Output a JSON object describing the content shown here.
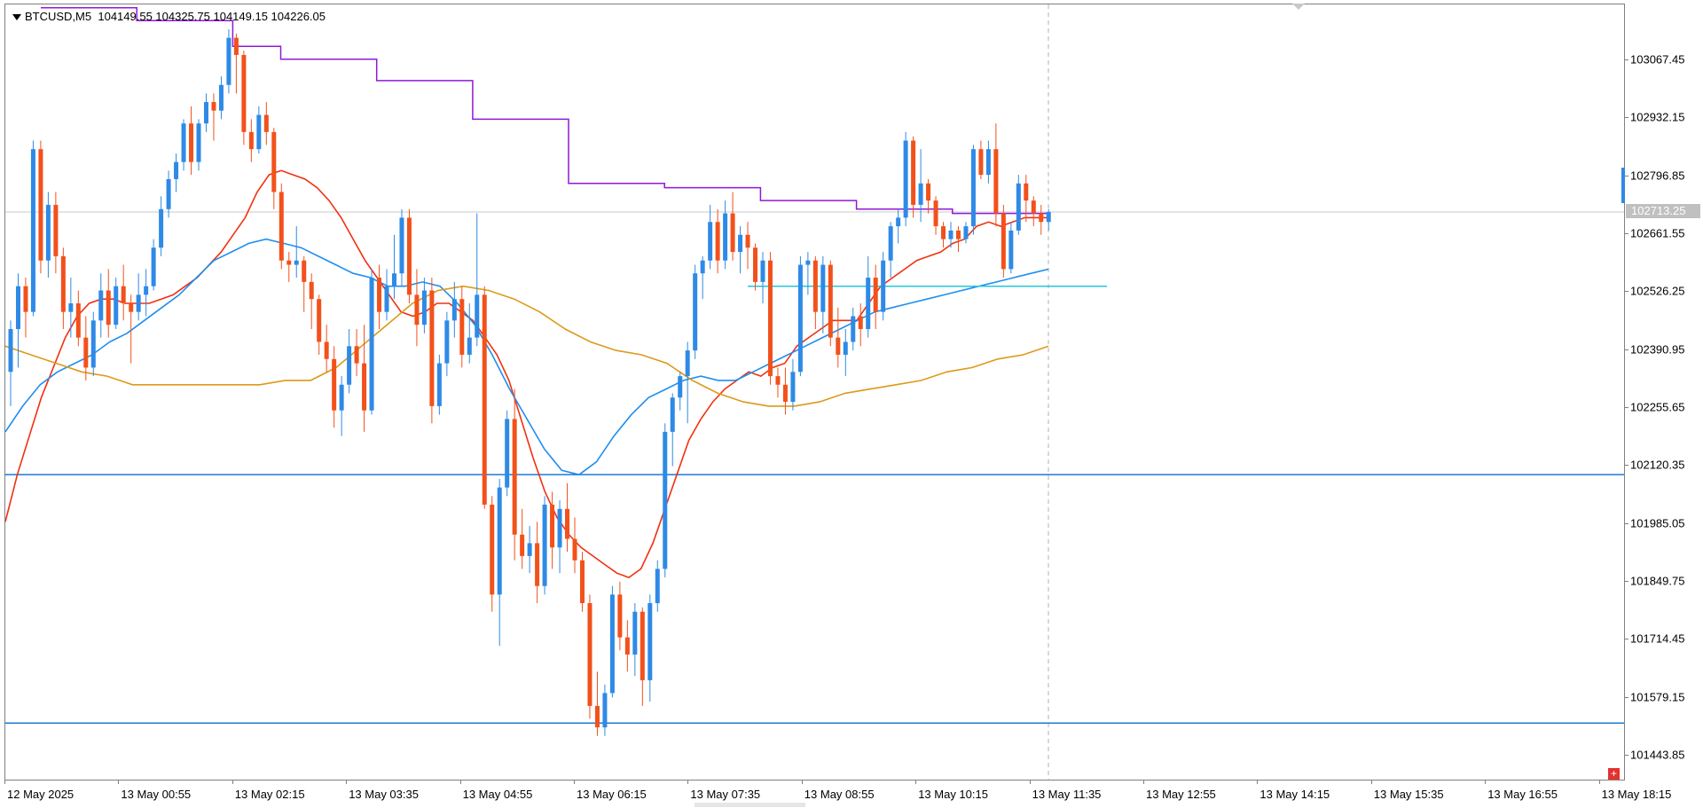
{
  "symbol": {
    "name": "BTCUSD,M5",
    "ohlc": "104149.55 104325.75 104149.15 104226.05"
  },
  "price_axis": {
    "labels": [
      "103067.45",
      "102932.15",
      "102796.85",
      "102661.55",
      "102526.25",
      "102390.95",
      "102255.65",
      "102120.35",
      "101985.05",
      "101849.75",
      "101714.45",
      "101579.15",
      "101443.85"
    ]
  },
  "current_price": {
    "label": "102713.25",
    "value": 102713.25
  },
  "time_axis": {
    "labels": [
      "12 May 2025",
      "13 May 00:55",
      "13 May 02:15",
      "13 May 03:35",
      "13 May 04:55",
      "13 May 06:15",
      "13 May 07:35",
      "13 May 08:55",
      "13 May 10:15",
      "13 May 11:35",
      "13 May 12:55",
      "13 May 14:15",
      "13 May 15:35",
      "13 May 16:55",
      "13 May 18:15"
    ]
  },
  "scroll_marker": {
    "label": "+"
  },
  "colors": {
    "bull": "#2e8ae6",
    "bear": "#f2511b",
    "ma_fast": "#f2300f",
    "ma_mid": "#1e8ef0",
    "ma_slow": "#dc9a19",
    "step_line": "#9019d6",
    "hline": "#1b78d8",
    "cyan_line": "#26c6da",
    "grid_price": "#c8c8c8",
    "vline": "#b0b0b0"
  },
  "chart_data": {
    "type": "candlestick",
    "timeframe": "M5",
    "ylim": [
      101400,
      103160
    ],
    "candles": [
      [
        102340,
        102460,
        102260,
        102440
      ],
      [
        102440,
        102570,
        102350,
        102540
      ],
      [
        102540,
        102560,
        102420,
        102480
      ],
      [
        102480,
        102880,
        102470,
        102860
      ],
      [
        102860,
        102880,
        102570,
        102600
      ],
      [
        102600,
        102760,
        102560,
        102730
      ],
      [
        102730,
        102760,
        102570,
        102610
      ],
      [
        102610,
        102630,
        102440,
        102480
      ],
      [
        102480,
        102560,
        102420,
        102500
      ],
      [
        102500,
        102530,
        102400,
        102420
      ],
      [
        102420,
        102470,
        102320,
        102350
      ],
      [
        102350,
        102480,
        102330,
        102460
      ],
      [
        102460,
        102570,
        102420,
        102530
      ],
      [
        102530,
        102580,
        102420,
        102450
      ],
      [
        102450,
        102560,
        102440,
        102540
      ],
      [
        102540,
        102590,
        102460,
        102500
      ],
      [
        102500,
        102520,
        102360,
        102480
      ],
      [
        102480,
        102570,
        102460,
        102520
      ],
      [
        102520,
        102580,
        102470,
        102540
      ],
      [
        102540,
        102650,
        102530,
        102630
      ],
      [
        102630,
        102750,
        102610,
        102720
      ],
      [
        102720,
        102810,
        102700,
        102790
      ],
      [
        102790,
        102850,
        102760,
        102830
      ],
      [
        102830,
        102930,
        102810,
        102920
      ],
      [
        102920,
        102960,
        102800,
        102830
      ],
      [
        102830,
        102930,
        102810,
        102920
      ],
      [
        102920,
        102990,
        102900,
        102970
      ],
      [
        102970,
        102990,
        102880,
        102950
      ],
      [
        102950,
        103030,
        102930,
        103010
      ],
      [
        103010,
        103140,
        102990,
        103120
      ],
      [
        103120,
        103130,
        102990,
        103080
      ],
      [
        103080,
        103090,
        102870,
        102900
      ],
      [
        102900,
        102930,
        102830,
        102860
      ],
      [
        102860,
        102960,
        102850,
        102940
      ],
      [
        102940,
        102970,
        102870,
        102900
      ],
      [
        102900,
        102910,
        102720,
        102760
      ],
      [
        102760,
        102780,
        102580,
        102600
      ],
      [
        102600,
        102620,
        102550,
        102590
      ],
      [
        102590,
        102680,
        102560,
        102600
      ],
      [
        102600,
        102610,
        102480,
        102550
      ],
      [
        102550,
        102570,
        102440,
        102510
      ],
      [
        102510,
        102520,
        102380,
        102410
      ],
      [
        102410,
        102450,
        102340,
        102370
      ],
      [
        102370,
        102400,
        102210,
        102250
      ],
      [
        102250,
        102330,
        102190,
        102310
      ],
      [
        102310,
        102440,
        102290,
        102400
      ],
      [
        102400,
        102440,
        102330,
        102360
      ],
      [
        102360,
        102450,
        102200,
        102250
      ],
      [
        102250,
        102580,
        102240,
        102560
      ],
      [
        102560,
        102590,
        102440,
        102480
      ],
      [
        102480,
        102580,
        102460,
        102540
      ],
      [
        102540,
        102660,
        102510,
        102570
      ],
      [
        102570,
        102720,
        102540,
        102700
      ],
      [
        102700,
        102720,
        102500,
        102520
      ],
      [
        102520,
        102580,
        102400,
        102450
      ],
      [
        102450,
        102560,
        102430,
        102530
      ],
      [
        102530,
        102560,
        102220,
        102260
      ],
      [
        102260,
        102380,
        102240,
        102360
      ],
      [
        102360,
        102480,
        102330,
        102460
      ],
      [
        102460,
        102550,
        102420,
        102510
      ],
      [
        102510,
        102540,
        102350,
        102380
      ],
      [
        102380,
        102500,
        102360,
        102420
      ],
      [
        102420,
        102710,
        102400,
        102520
      ],
      [
        102520,
        102540,
        102020,
        102030
      ],
      [
        102030,
        102050,
        101780,
        101820
      ],
      [
        101820,
        102090,
        101700,
        102070
      ],
      [
        102070,
        102250,
        102050,
        102230
      ],
      [
        102230,
        102300,
        101900,
        101960
      ],
      [
        101960,
        102020,
        101880,
        101910
      ],
      [
        101910,
        101980,
        101870,
        101940
      ],
      [
        101940,
        101990,
        101800,
        101840
      ],
      [
        101840,
        102050,
        101820,
        102030
      ],
      [
        102030,
        102060,
        101880,
        101930
      ],
      [
        101930,
        102040,
        101870,
        102020
      ],
      [
        102020,
        102080,
        101920,
        101950
      ],
      [
        101950,
        102000,
        101870,
        101900
      ],
      [
        101900,
        101920,
        101780,
        101800
      ],
      [
        101800,
        101820,
        101530,
        101560
      ],
      [
        101560,
        101640,
        101490,
        101510
      ],
      [
        101510,
        101610,
        101490,
        101590
      ],
      [
        101590,
        101840,
        101580,
        101820
      ],
      [
        101820,
        101850,
        101690,
        101720
      ],
      [
        101720,
        101760,
        101640,
        101680
      ],
      [
        101680,
        101800,
        101630,
        101780
      ],
      [
        101780,
        101790,
        101560,
        101620
      ],
      [
        101620,
        101820,
        101570,
        101800
      ],
      [
        101800,
        101900,
        101780,
        101880
      ],
      [
        101880,
        102220,
        101860,
        102200
      ],
      [
        102200,
        102290,
        102120,
        102280
      ],
      [
        102280,
        102340,
        102250,
        102330
      ],
      [
        102330,
        102410,
        102220,
        102390
      ],
      [
        102390,
        102590,
        102370,
        102570
      ],
      [
        102570,
        102610,
        102510,
        102600
      ],
      [
        102600,
        102730,
        102580,
        102690
      ],
      [
        102690,
        102720,
        102570,
        102600
      ],
      [
        102600,
        102740,
        102580,
        102710
      ],
      [
        102710,
        102760,
        102600,
        102620
      ],
      [
        102620,
        102680,
        102570,
        102660
      ],
      [
        102660,
        102690,
        102580,
        102630
      ],
      [
        102630,
        102640,
        102530,
        102550
      ],
      [
        102550,
        102620,
        102500,
        102600
      ],
      [
        102600,
        102620,
        102310,
        102330
      ],
      [
        102330,
        102350,
        102280,
        102310
      ],
      [
        102310,
        102350,
        102240,
        102270
      ],
      [
        102270,
        102370,
        102250,
        102340
      ],
      [
        102340,
        102610,
        102330,
        102590
      ],
      [
        102590,
        102620,
        102520,
        102600
      ],
      [
        102600,
        102610,
        102440,
        102480
      ],
      [
        102480,
        102610,
        102430,
        102590
      ],
      [
        102590,
        102600,
        102400,
        102420
      ],
      [
        102420,
        102490,
        102350,
        102380
      ],
      [
        102380,
        102440,
        102330,
        102410
      ],
      [
        102410,
        102490,
        102390,
        102470
      ],
      [
        102470,
        102500,
        102400,
        102440
      ],
      [
        102440,
        102610,
        102420,
        102560
      ],
      [
        102560,
        102590,
        102440,
        102480
      ],
      [
        102480,
        102620,
        102460,
        102600
      ],
      [
        102600,
        102690,
        102560,
        102680
      ],
      [
        102680,
        102720,
        102640,
        102700
      ],
      [
        102700,
        102900,
        102680,
        102880
      ],
      [
        102880,
        102890,
        102700,
        102730
      ],
      [
        102730,
        102860,
        102690,
        102780
      ],
      [
        102780,
        102790,
        102710,
        102740
      ],
      [
        102740,
        102750,
        102660,
        102680
      ],
      [
        102680,
        102690,
        102630,
        102650
      ],
      [
        102650,
        102690,
        102630,
        102670
      ],
      [
        102670,
        102680,
        102620,
        102650
      ],
      [
        102650,
        102690,
        102640,
        102680
      ],
      [
        102680,
        102870,
        102660,
        102860
      ],
      [
        102860,
        102880,
        102790,
        102800
      ],
      [
        102800,
        102880,
        102780,
        102860
      ],
      [
        102860,
        102920,
        102680,
        102710
      ],
      [
        102710,
        102730,
        102560,
        102580
      ],
      [
        102580,
        102690,
        102570,
        102670
      ],
      [
        102670,
        102800,
        102660,
        102780
      ],
      [
        102780,
        102800,
        102690,
        102740
      ],
      [
        102740,
        102750,
        102680,
        102710
      ],
      [
        102710,
        102730,
        102660,
        102690
      ],
      [
        102690,
        102720,
        102670,
        102713.25
      ]
    ],
    "moving_averages": [
      {
        "values": [
          101990,
          102100,
          102190,
          102280,
          102350,
          102420,
          102470,
          102500,
          102510,
          102510,
          102500,
          102500,
          102500,
          102510,
          102520,
          102540,
          102560,
          102590,
          102620,
          102660,
          102700,
          102760,
          102800,
          102810,
          102800,
          102790,
          102770,
          102740,
          102700,
          102650,
          102600,
          102560,
          102520,
          102480,
          102470,
          102480,
          102500,
          102500,
          102480,
          102460,
          102420,
          102380,
          102320,
          102230,
          102140,
          102060,
          102000,
          101960,
          101930,
          101910,
          101890,
          101870,
          101860,
          101880,
          101940,
          102020,
          102100,
          102180,
          102230,
          102270,
          102300,
          102320,
          102340,
          102330,
          102350,
          102360,
          102400,
          102420,
          102440,
          102460,
          102460,
          102460,
          102500,
          102540,
          102560,
          102580,
          102600,
          102610,
          102620,
          102640,
          102650,
          102680,
          102690,
          102680,
          102690,
          102700,
          102700,
          102700
        ]
      },
      {
        "values": [
          102200,
          102260,
          102310,
          102340,
          102360,
          102380,
          102410,
          102430,
          102460,
          102490,
          102520,
          102560,
          102600,
          102620,
          102640,
          102650,
          102640,
          102630,
          102610,
          102590,
          102570,
          102560,
          102540,
          102540,
          102550,
          102540,
          102500,
          102450,
          102380,
          102300,
          102230,
          102160,
          102110,
          102100,
          102130,
          102190,
          102240,
          102280,
          102300,
          102320,
          102330,
          102320,
          102320,
          102340,
          102360,
          102380,
          102400,
          102420,
          102440,
          102460,
          102480,
          102490,
          102500,
          102510,
          102520,
          102530,
          102540,
          102550,
          102560,
          102570,
          102580
        ]
      },
      {
        "values": [
          102400,
          102380,
          102360,
          102340,
          102330,
          102310,
          102310,
          102310,
          102310,
          102310,
          102310,
          102320,
          102320,
          102350,
          102400,
          102450,
          102500,
          102530,
          102540,
          102530,
          102510,
          102480,
          102440,
          102410,
          102390,
          102380,
          102360,
          102320,
          102290,
          102270,
          102260,
          102260,
          102270,
          102290,
          102300,
          102310,
          102320,
          102340,
          102350,
          102370,
          102380,
          102400
        ]
      }
    ],
    "step_line": [
      103190,
      103190,
      103160,
      103160,
      103100,
      103070,
      103070,
      103020,
      103020,
      102930,
      102930,
      102780,
      102780,
      102770,
      102770,
      102740,
      102740,
      102720,
      102720,
      102710,
      102710
    ],
    "horizontal_lines": [
      102100,
      101520
    ],
    "cyan_segment": {
      "price": 102540
    },
    "current_price": 102713.25
  }
}
